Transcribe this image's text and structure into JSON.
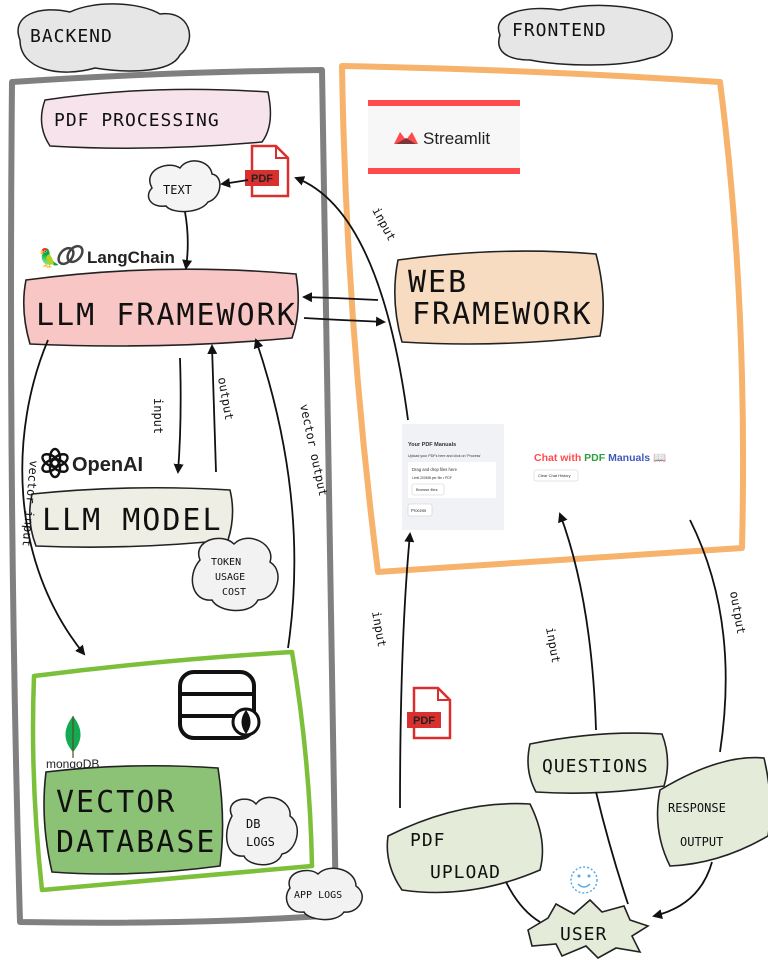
{
  "headers": {
    "backend": "BACKEND",
    "frontend": "FRONTEND"
  },
  "backend": {
    "section_title": "PDF PROCESSING",
    "text_cloud": "TEXT",
    "pdf_icon_label": "PDF",
    "langchain_label": "LangChain",
    "llm_framework": "LLM FRAMEWORK",
    "openai_label": "OpenAI",
    "llm_model": "LLM MODEL",
    "token_cloud": [
      "TOKEN",
      "USAGE",
      "COST"
    ],
    "mongodb_label": "mongoDB.",
    "vector_database": [
      "VECTOR",
      "DATABASE"
    ],
    "db_logs": [
      "DB",
      "LOGS"
    ],
    "app_logs": "APP LOGS",
    "arrow_labels": {
      "input": "input",
      "output": "output",
      "vector_output": "vector output",
      "vector_input": "vector input"
    }
  },
  "frontend": {
    "streamlit_label": "Streamlit",
    "web_framework": [
      "WEB",
      "FRAMEWORK"
    ],
    "input_arrow_label": "input",
    "app_ui": {
      "sidebar_title": "Your PDF Manuals",
      "sidebar_hint": "Upload your PDFs here and click on 'Process'",
      "drop_text": "Drag and drop files here",
      "drop_limit": "Limit 200MB per file • PDF",
      "browse_button": "Browse files",
      "process_button": "Process",
      "chat_title_prefix": "Chat with ",
      "chat_title_pdf": "PDF",
      "chat_title_suffix": " Manuals 📖",
      "clear_button": "Clear Chat History"
    }
  },
  "user_flow": {
    "pdf_upload": [
      "PDF",
      "UPLOAD"
    ],
    "questions": "QUESTIONS",
    "response_output": [
      "RESPONSE",
      "OUTPUT"
    ],
    "user": "USER",
    "pdf_icon_label": "PDF",
    "arrow_labels": {
      "input": "input",
      "output": "output"
    }
  },
  "colors": {
    "backend_border": "#808080",
    "frontend_border": "#f7b26b",
    "mongo_border": "#7cbf3a",
    "llm_framework_fill": "#f9c6c6",
    "web_framework_fill": "#f8dcc2",
    "vector_db_fill": "#8cc276",
    "pdf_red": "#d9302f",
    "streamlit_red": "#ff4b4b",
    "note_fill": "#e4ebd8",
    "cloud_fill": "#ececec"
  }
}
